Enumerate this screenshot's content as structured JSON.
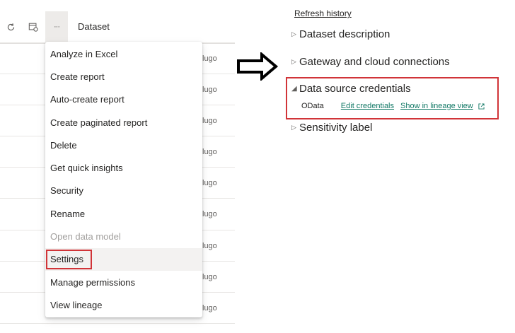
{
  "toolbar": {
    "refresh_icon": "refresh-icon",
    "schedule_refresh_icon": "calendar-refresh-icon",
    "more_options_label": "···",
    "column_header": "Dataset"
  },
  "rows": {
    "owner_text": [
      "lugo",
      "lugo",
      "lugo",
      "lugo",
      "lugo",
      "lugo",
      "lugo",
      "lugo",
      "lugo"
    ]
  },
  "context_menu": {
    "items": [
      {
        "label": "Analyze in Excel"
      },
      {
        "label": "Create report"
      },
      {
        "label": "Auto-create report"
      },
      {
        "label": "Create paginated report"
      },
      {
        "label": "Delete"
      },
      {
        "label": "Get quick insights"
      },
      {
        "label": "Security"
      },
      {
        "label": "Rename"
      },
      {
        "label": "Open data model"
      },
      {
        "label": "Settings"
      },
      {
        "label": "Manage permissions"
      },
      {
        "label": "View lineage"
      }
    ]
  },
  "settings": {
    "refresh_history_link": "Refresh history",
    "sections": [
      {
        "label": "Dataset description",
        "expanded": false
      },
      {
        "label": "Gateway and cloud connections",
        "expanded": false
      },
      {
        "label": "Data source credentials",
        "expanded": true
      },
      {
        "label": "Sensitivity label",
        "expanded": false
      }
    ],
    "credentials": {
      "source_name": "OData",
      "edit_link": "Edit credentials",
      "lineage_link": "Show in lineage view"
    }
  },
  "colors": {
    "highlight": "#d13438",
    "link": "#117865",
    "text": "#252423",
    "disabled": "#a19f9d"
  }
}
